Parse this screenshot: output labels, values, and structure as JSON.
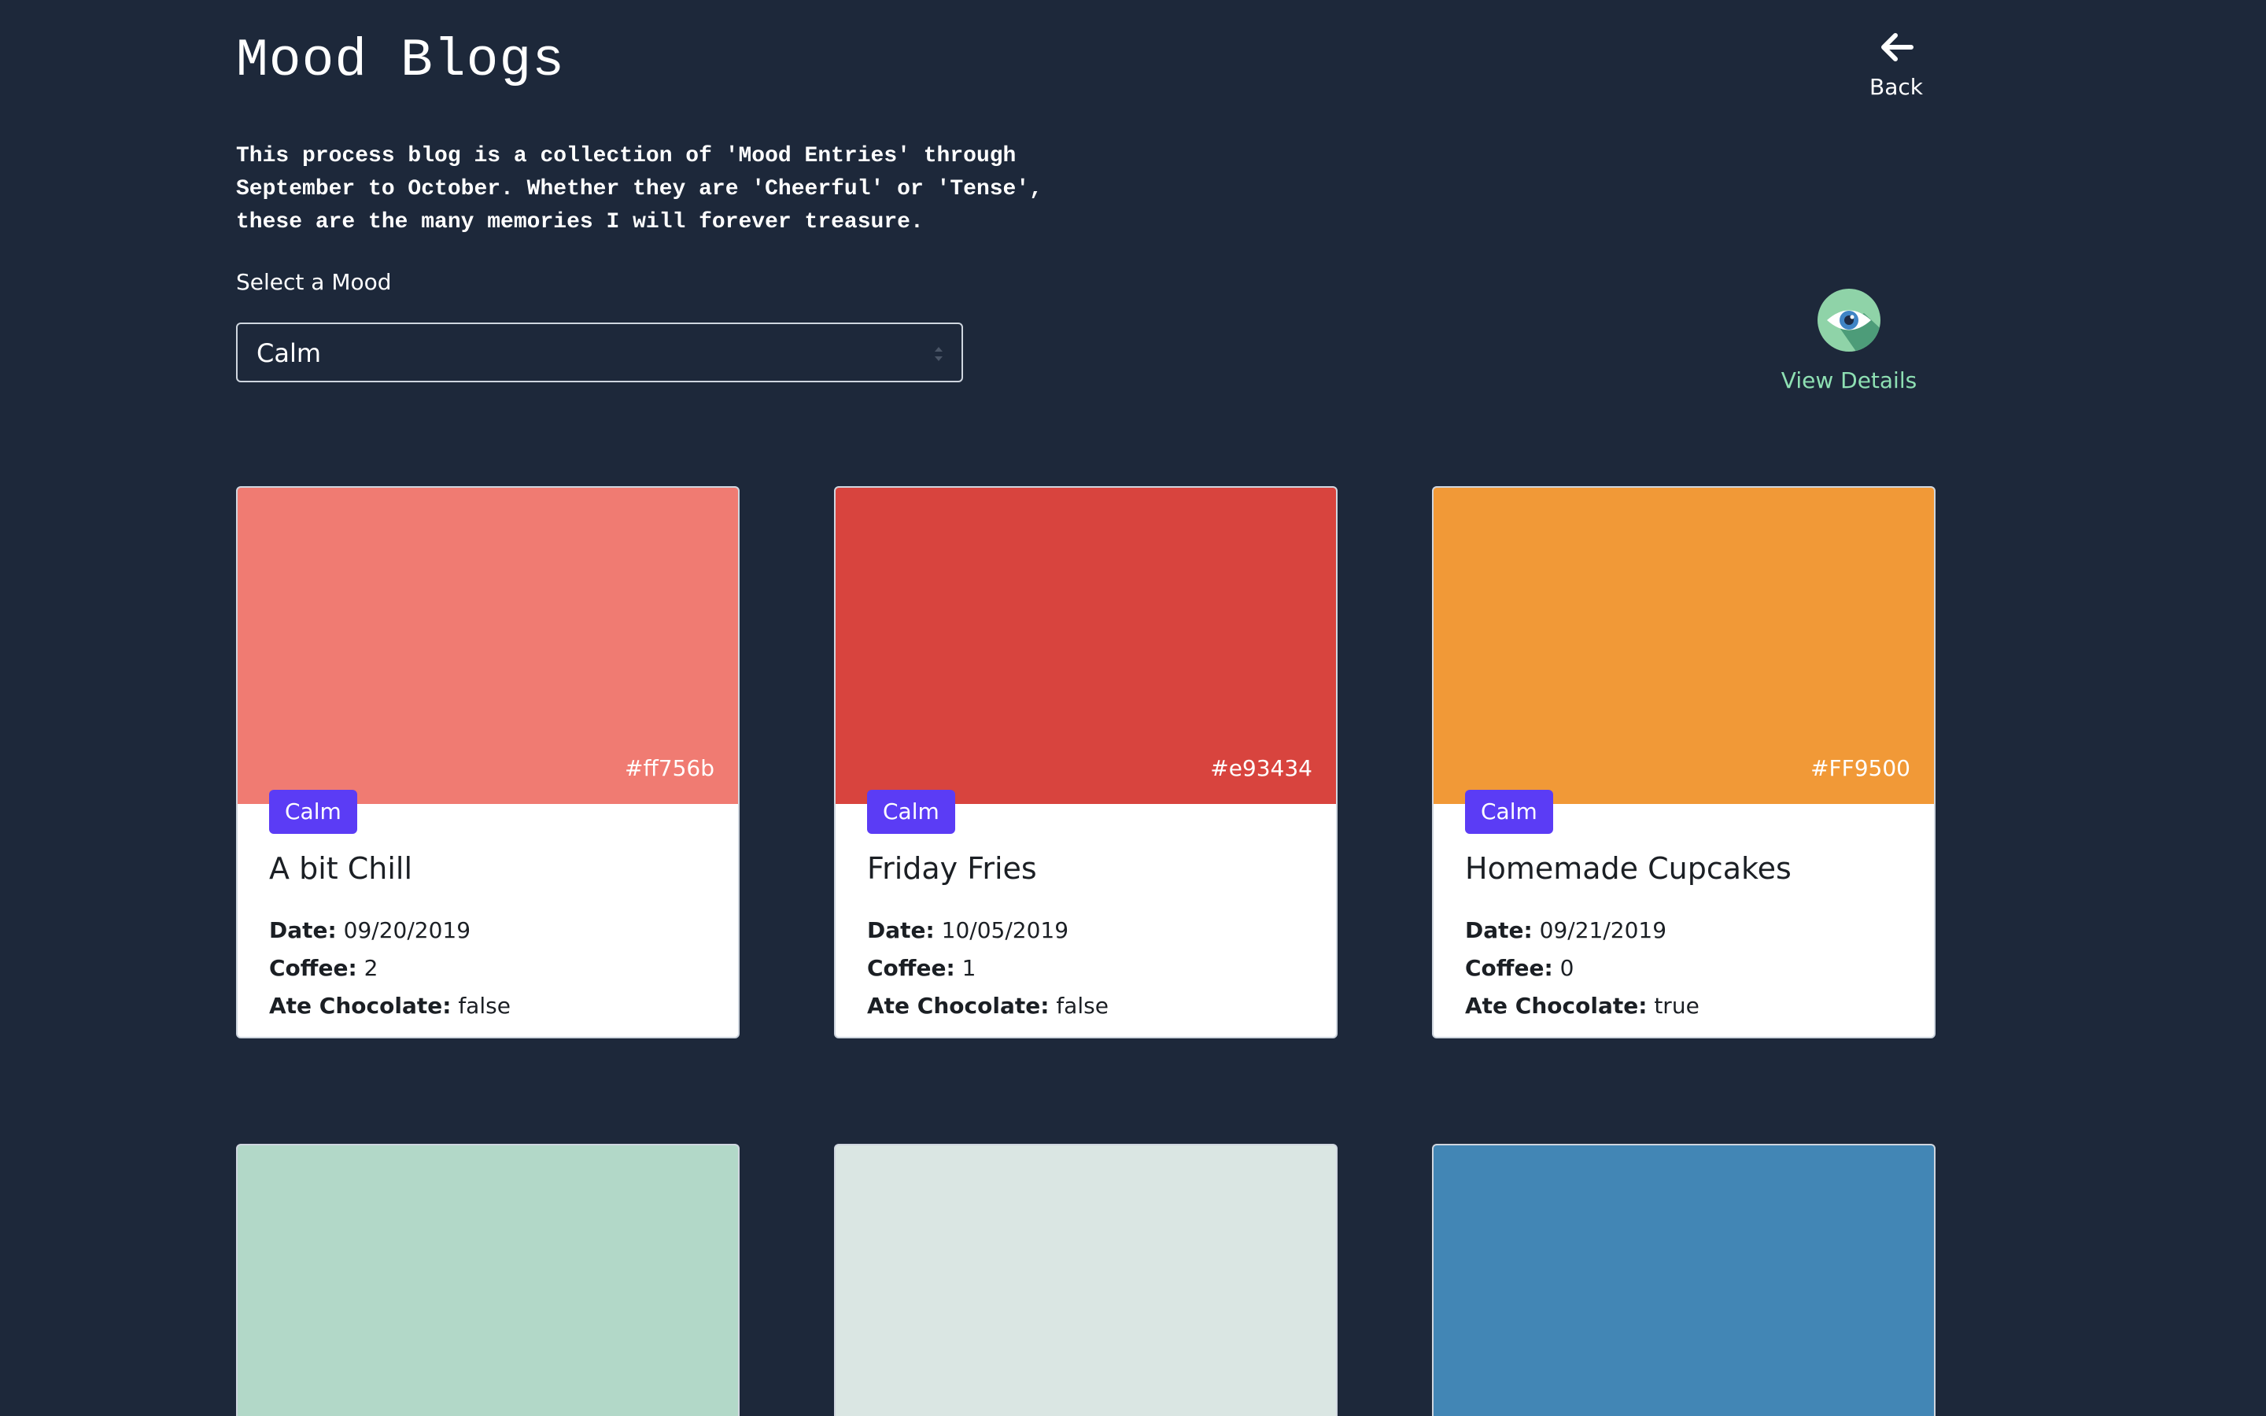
{
  "header": {
    "title": "Mood Blogs",
    "intro": "This process blog is a collection of 'Mood Entries' through September to October. Whether they are 'Cheerful' or 'Tense', these are the many memories I will forever treasure.",
    "back_label": "Back",
    "back_icon": "arrow-left-icon"
  },
  "filter": {
    "label": "Select a Mood",
    "selected": "Calm"
  },
  "view_details": {
    "label": "View Details",
    "icon": "eye-icon",
    "label_color": "#8ee0b3"
  },
  "labels": {
    "date": "Date:",
    "coffee": "Coffee:",
    "chocolate": "Ate Chocolate:"
  },
  "badge_color": "#5b3cf5",
  "cards": [
    {
      "color": "#f07b72",
      "hex_label": "#ff756b",
      "mood": "Calm",
      "title": "A bit Chill",
      "date": "09/20/2019",
      "coffee": "2",
      "chocolate": "false"
    },
    {
      "color": "#d8443e",
      "hex_label": "#e93434",
      "mood": "Calm",
      "title": "Friday Fries",
      "date": "10/05/2019",
      "coffee": "1",
      "chocolate": "false"
    },
    {
      "color": "#f19937",
      "hex_label": "#FF9500",
      "mood": "Calm",
      "title": "Homemade Cupcakes",
      "date": "09/21/2019",
      "coffee": "0",
      "chocolate": "true"
    },
    {
      "color": "#b2d8c8"
    },
    {
      "color": "#dae6e3"
    },
    {
      "color": "#4286b5"
    }
  ]
}
